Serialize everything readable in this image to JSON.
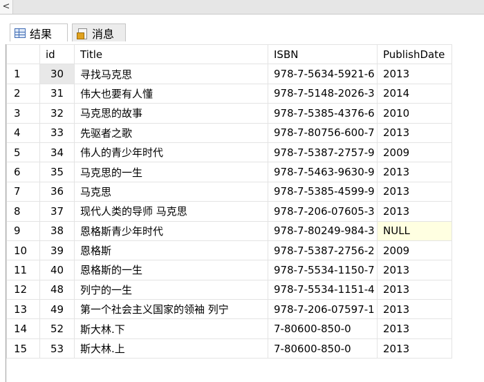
{
  "tabs": {
    "results_label": "结果",
    "messages_label": "消息"
  },
  "grid": {
    "columns": [
      "",
      "id",
      "Title",
      "ISBN",
      "PublishDate"
    ],
    "rows": [
      {
        "n": "1",
        "id": "30",
        "title": "寻找马克思",
        "isbn": "978-7-5634-5921-6",
        "date": "2013"
      },
      {
        "n": "2",
        "id": "31",
        "title": "伟大也要有人懂",
        "isbn": "978-7-5148-2026-3",
        "date": "2014"
      },
      {
        "n": "3",
        "id": "32",
        "title": "马克思的故事",
        "isbn": "978-7-5385-4376-6",
        "date": "2010"
      },
      {
        "n": "4",
        "id": "33",
        "title": "先驱者之歌",
        "isbn": "978-7-80756-600-7",
        "date": "2013"
      },
      {
        "n": "5",
        "id": "34",
        "title": "伟人的青少年时代",
        "isbn": "978-7-5387-2757-9",
        "date": "2009"
      },
      {
        "n": "6",
        "id": "35",
        "title": "马克思的一生",
        "isbn": "978-7-5463-9630-9",
        "date": "2013"
      },
      {
        "n": "7",
        "id": "36",
        "title": "马克思",
        "isbn": "978-7-5385-4599-9",
        "date": "2013"
      },
      {
        "n": "8",
        "id": "37",
        "title": "现代人类的导师 马克思",
        "isbn": "978-7-206-07605-3",
        "date": "2013"
      },
      {
        "n": "9",
        "id": "38",
        "title": "恩格斯青少年时代",
        "isbn": "978-7-80249-984-3",
        "date": "NULL"
      },
      {
        "n": "10",
        "id": "39",
        "title": "恩格斯",
        "isbn": "978-7-5387-2756-2",
        "date": "2009"
      },
      {
        "n": "11",
        "id": "40",
        "title": "恩格斯的一生",
        "isbn": "978-7-5534-1150-7",
        "date": "2013"
      },
      {
        "n": "12",
        "id": "48",
        "title": "列宁的一生",
        "isbn": "978-7-5534-1151-4",
        "date": "2013"
      },
      {
        "n": "13",
        "id": "49",
        "title": "第一个社会主义国家的领袖 列宁",
        "isbn": "978-7-206-07597-1",
        "date": "2013"
      },
      {
        "n": "14",
        "id": "52",
        "title": "斯大林.下",
        "isbn": "7-80600-850-0",
        "date": "2013"
      },
      {
        "n": "15",
        "id": "53",
        "title": "斯大林.上",
        "isbn": "7-80600-850-0",
        "date": "2013"
      }
    ]
  },
  "icons": {
    "scroll_left": "chevron-left-icon",
    "results": "grid-icon",
    "messages": "message-icon"
  },
  "colors": {
    "null_cell": "#ffffe1",
    "selected_cell": "#e8e8e8"
  }
}
